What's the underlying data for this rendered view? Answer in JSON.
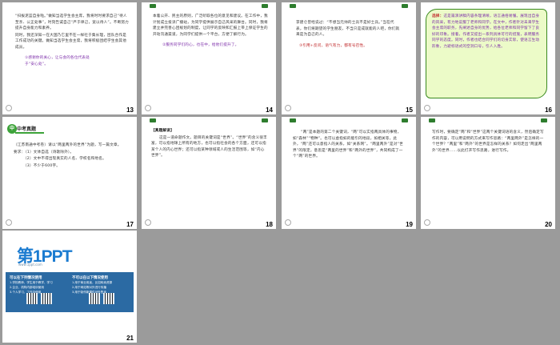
{
  "slides": [
    {
      "number": "13",
      "paragraphs": [
        "“扫拔泥蓝自身啦。”做知当选学生会主席，我将时时要求自己“待人至亲、公正处事”，时刻告诫自己“严于律己，宽以待人”。不断努力提升自身能力和素养。",
        "同时，我还深知一在大国乃它里不在一样社于集长理，团队合作是工作成功的关键。做知当选学生会主席，我将积极团结学生会其他成员。"
      ],
      "note": "①感谢你的关心，让与会的各位代表处于“安心处”。"
    },
    {
      "number": "14",
      "paragraphs": [
        "本着公开、民主的原则，广泛听取各位的意见和建议。在工作中，我计划成立投诉广播站，为同学提供展示自己风采的舞台。同时，我将建立并完善心团规划的制度，让同学的反映和汇报上带上保证学生的开动沟通渠道，为同学们提供一个平台，方便了解行为。"
      ],
      "note": "②服务同学们的心，也在中，给他们提升了。"
    },
    {
      "number": "15",
      "paragraphs": [
        "李建仑曾经说过：“不想当元帅的士兵不是好士兵。”当在代表，你们将期望的学生朋友，不当只是成就能的人吧，你们就来是为自己的人。"
      ],
      "note": "③引用+反问，语气有力，都有号召性。"
    },
    {
      "number": "16",
      "label": "选择：",
      "paragraphs": [
        "这是篇演讲稿内容条理清晰，语言通俗易懂。展现出自身的风采，有力地说服了老师和同学。在文中，作者针对未来学生会主席的职务，先阐述自身的优势，给各位老师和同学留下了良好的印象。接着，作者又提出一系列具体可行的措施，表明服务同学的态度。同时，作者也结合同学们的切身实际，使语言生动形象，力避标语式的空洞口号，引人入胜。"
      ]
    },
    {
      "number": "17",
      "tag": "中考真题",
      "paragraphs": [
        "（江苏南通中考卷）请以“两里两外的世界”为题，写一篇文章。",
        "要求：（1）文体自选（诗歌除外）。",
        "（2）文中不得出现真实的人名、学校名和地名。",
        "（3）不少于600字。"
      ]
    },
    {
      "number": "18",
      "title": "【真题解读】",
      "paragraphs": [
        "这是一道命题作文。题目的关键词是“世界”。“世界”的含义很丰富，可以指地球上所有的地方，也可以指社会的各个方面，还可以指某个人的内心世界；还可以指某种领域或人的生活范围等，如“内心世界”。"
      ]
    },
    {
      "number": "19",
      "paragraphs": [
        "“两”是本题的第二个关键词，“两”可以实指两具体的事物，如“森林”“物种”。也可以虚指如的能引的地段，如相关等，此外，“两”还可以意指人的关系，如“关系网”。“两里两外”是对“世界”的限定，意思是“两里的世界”和“两外的世界”，共同构成了一个“两”的世界。"
      ]
    },
    {
      "number": "20",
      "paragraphs": [
        "写作时，要确定“两”和“世界”这两个关键词语的含义，然后确定写作的内容，可以用说明的方式来写作思路：“两里两外”是怎样的一个世界？“两里”和“两外”的世界是怎样的关系？如何走出“两里两外”的世界……以此打开写作思路，进行写作。"
      ]
    },
    {
      "number": "21",
      "logo_main": "第1PPT",
      "logo_sub": "www.1ppt.com",
      "col1_title": "可以在下列情况使用",
      "col1_lines": [
        "1.学校教师、学生用于教学、学习",
        "2.企业、机构内部培训使用",
        "3.个人学习、工作中使用"
      ],
      "col2_title": "不可以在以下情况使用",
      "col2_lines": [
        "1.用于商业用途，比如转卖资源",
        "2.用于网站等对外进行传播",
        "3.用于制作新课件对外售卖"
      ]
    }
  ]
}
